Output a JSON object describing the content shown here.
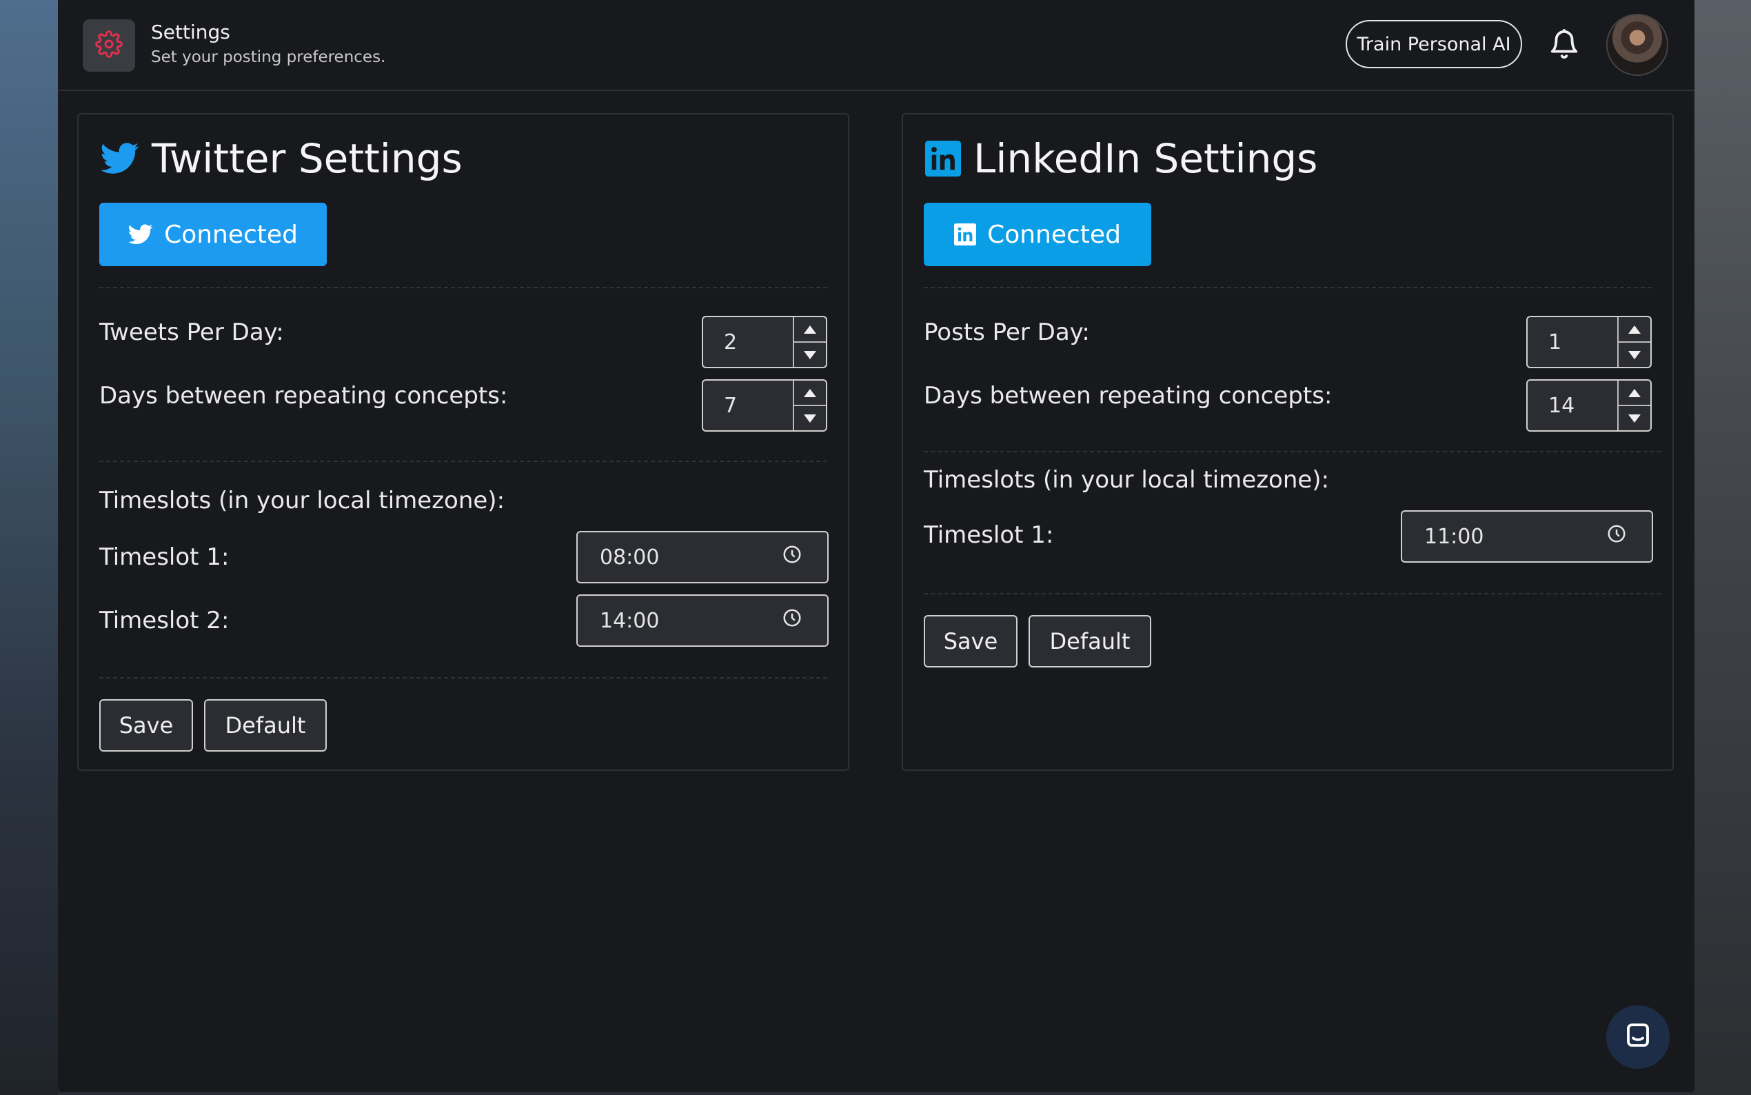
{
  "header": {
    "title": "Settings",
    "subtitle": "Set your posting preferences.",
    "train_button": "Train Personal AI",
    "icons": {
      "settings": "gear-icon",
      "bell": "bell-icon",
      "avatar": "user-avatar"
    },
    "accent_color": "#e0314e"
  },
  "twitter": {
    "title": "Twitter Settings",
    "connected_label": "Connected",
    "brand_color": "#1d9bf0",
    "tweets_per_day_label": "Tweets Per Day:",
    "tweets_per_day_value": "2",
    "repeat_days_label": "Days between repeating concepts:",
    "repeat_days_value": "7",
    "timeslots_heading": "Timeslots (in your local timezone):",
    "timeslots": [
      {
        "label": "Timeslot 1:",
        "value": "08:00"
      },
      {
        "label": "Timeslot 2:",
        "value": "14:00"
      }
    ],
    "save_label": "Save",
    "default_label": "Default"
  },
  "linkedin": {
    "title": "LinkedIn Settings",
    "connected_label": "Connected",
    "brand_color": "#0a9ee6",
    "posts_per_day_label": "Posts Per Day:",
    "posts_per_day_value": "1",
    "repeat_days_label": "Days between repeating concepts:",
    "repeat_days_value": "14",
    "timeslots_heading": "Timeslots (in your local timezone):",
    "timeslots": [
      {
        "label": "Timeslot 1:",
        "value": "11:00"
      }
    ],
    "save_label": "Save",
    "default_label": "Default"
  },
  "chat_widget": {
    "icon": "chat-icon"
  }
}
